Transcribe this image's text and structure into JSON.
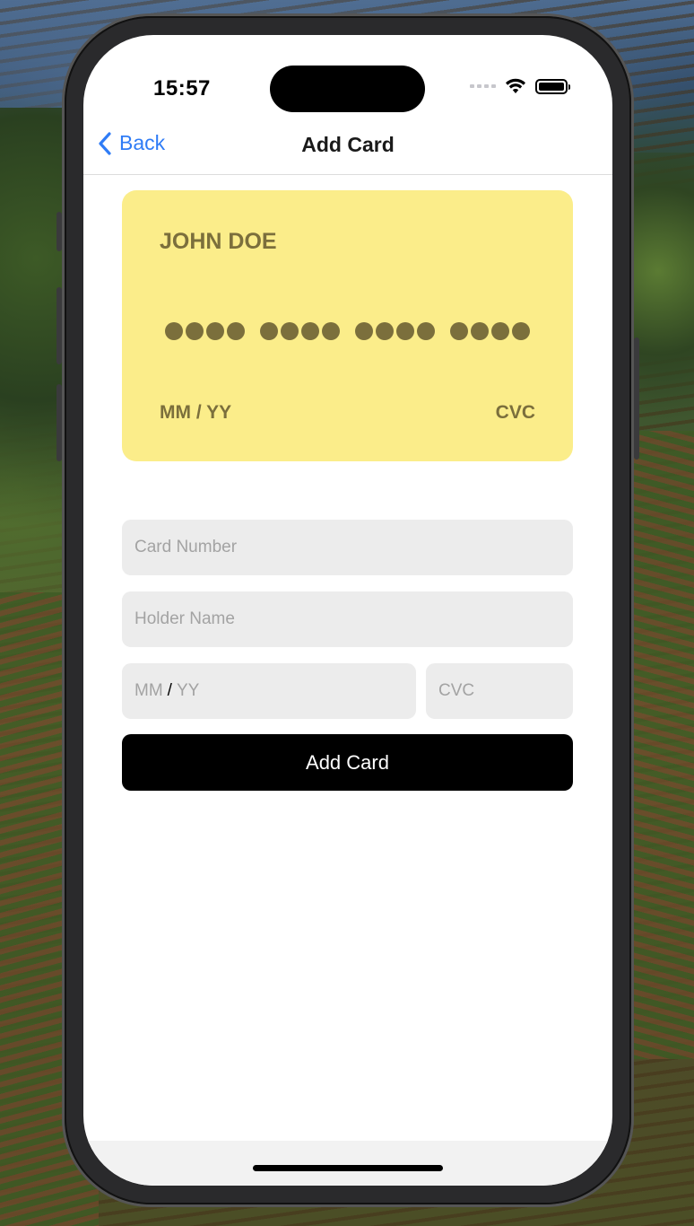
{
  "status_bar": {
    "time": "15:57",
    "icons": [
      "cellular-signal-icon",
      "wifi-icon",
      "battery-icon"
    ]
  },
  "navbar": {
    "back_label": "Back",
    "title": "Add Card"
  },
  "card_preview": {
    "holder_name": "JOHN DOE",
    "number_groups": 4,
    "expiry_placeholder": "MM / YY",
    "cvc_placeholder": "CVC",
    "background_color": "#fbed8a",
    "text_color": "#7b6f3c"
  },
  "form": {
    "card_number_placeholder": "Card Number",
    "holder_name_placeholder": "Holder Name",
    "expiry_month_placeholder": "MM",
    "expiry_separator": "/",
    "expiry_year_placeholder": "YY",
    "cvc_placeholder": "CVC",
    "submit_label": "Add Card"
  },
  "colors": {
    "accent": "#2f7cf6",
    "button_bg": "#000000",
    "field_bg": "#ececec"
  }
}
